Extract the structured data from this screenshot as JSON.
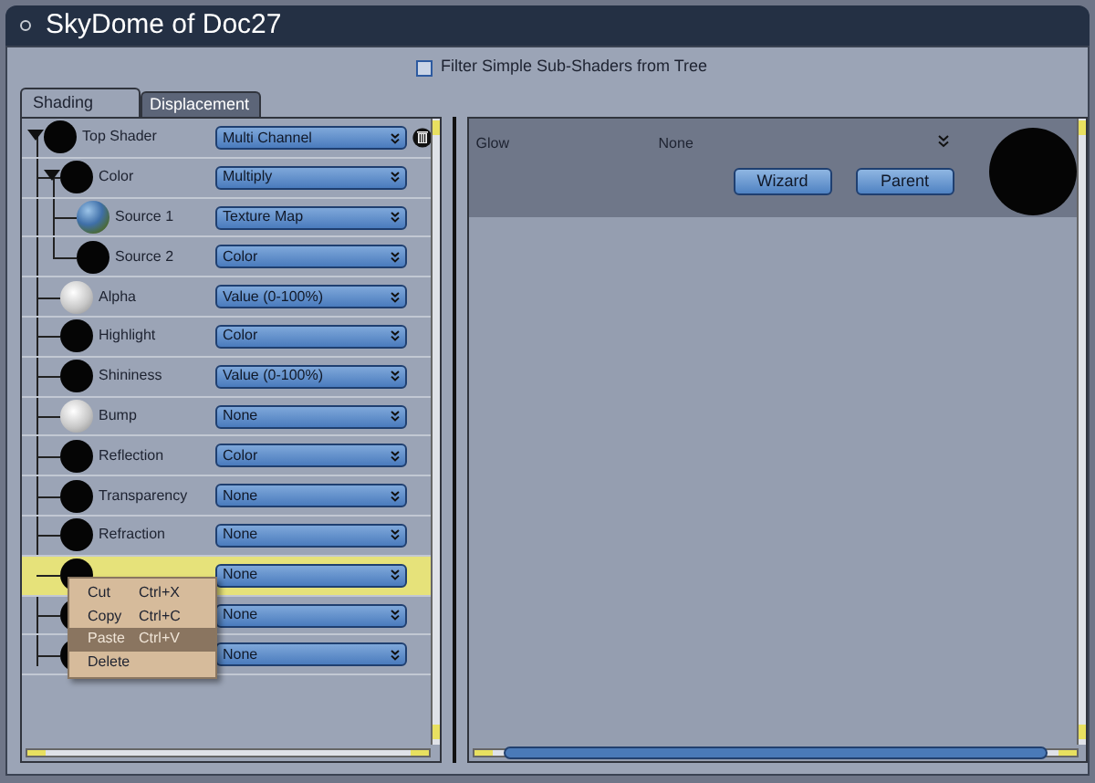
{
  "window": {
    "title": "SkyDome of Doc27"
  },
  "filter": {
    "label": "Filter Simple Sub-Shaders from Tree",
    "checked": false
  },
  "tabs": [
    {
      "label": "Shading",
      "selected": true
    },
    {
      "label": "Displacement",
      "selected": false
    }
  ],
  "tree": [
    {
      "label": "Top Shader",
      "kind": "black",
      "value": "Multi Channel",
      "expanded": true,
      "selected": false,
      "deletable": true,
      "children": [
        {
          "label": "Color",
          "kind": "black",
          "value": "Multiply",
          "expanded": true,
          "selected": false,
          "children": [
            {
              "label": "Source 1",
              "kind": "texture",
              "value": "Texture Map",
              "selected": false
            },
            {
              "label": "Source 2",
              "kind": "black",
              "value": "Color",
              "selected": false
            }
          ]
        },
        {
          "label": "Alpha",
          "kind": "white",
          "value": "Value (0-100%)",
          "selected": false
        },
        {
          "label": "Highlight",
          "kind": "black",
          "value": "Color",
          "selected": false
        },
        {
          "label": "Shininess",
          "kind": "black",
          "value": "Value (0-100%)",
          "selected": false
        },
        {
          "label": "Bump",
          "kind": "white",
          "value": "None",
          "selected": false
        },
        {
          "label": "Reflection",
          "kind": "black",
          "value": "Color",
          "selected": false
        },
        {
          "label": "Transparency",
          "kind": "black",
          "value": "None",
          "selected": false
        },
        {
          "label": "Refraction",
          "kind": "black",
          "value": "None",
          "selected": false
        },
        {
          "kind": "black",
          "value": "None",
          "selected": true
        },
        {
          "kind": "black",
          "value": "None",
          "selected": false
        },
        {
          "kind": "black",
          "value": "None",
          "selected": false
        }
      ]
    }
  ],
  "context_menu": [
    {
      "label": "Cut",
      "shortcut": "Ctrl+X",
      "selected": false
    },
    {
      "label": "Copy",
      "shortcut": "Ctrl+C",
      "selected": false
    },
    {
      "label": "Paste",
      "shortcut": "Ctrl+V",
      "selected": true
    },
    {
      "label": "Delete",
      "selected": false
    }
  ],
  "detail": {
    "name": "Glow",
    "value": "None",
    "buttons": [
      "Wizard",
      "Parent"
    ],
    "kind": "black"
  }
}
